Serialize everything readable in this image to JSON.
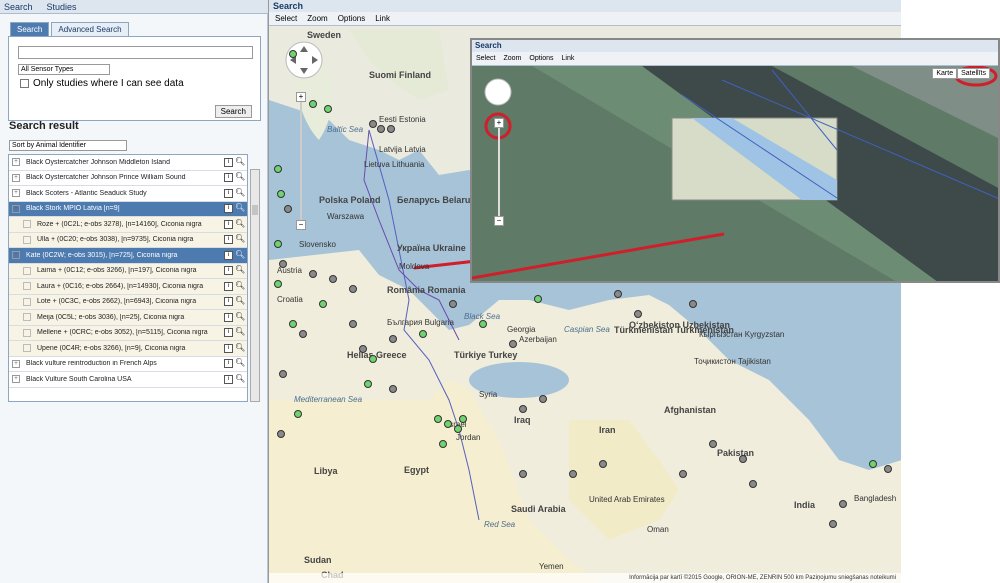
{
  "topbar": {
    "search": "Search",
    "studies": "Studies"
  },
  "tabs": [
    {
      "label": "Search"
    },
    {
      "label": "Advanced Search"
    }
  ],
  "search": {
    "value": "",
    "sensor_type": "All Sensor Types",
    "checkbox_label": "Only studies where I can see data",
    "button": "Search"
  },
  "result": {
    "title": "Search result",
    "sort": "Sort by Animal Identifier",
    "rows": [
      {
        "label": "Black Oystercatcher Johnson Middleton Island",
        "type": "study"
      },
      {
        "label": "Black Oystercatcher Johnson Prince William Sound",
        "type": "study"
      },
      {
        "label": "Black Scoters - Atlantic Seaduck Study",
        "type": "study"
      },
      {
        "label": "Black Stork MPIO Latvia [n=9]",
        "type": "selected"
      },
      {
        "label": "Roze + (0C2L; e-obs 3278), [n=14160], Ciconia nigra",
        "type": "child"
      },
      {
        "label": "Ulla + (0C20; e-obs 3038), [n=9735], Ciconia nigra",
        "type": "child"
      },
      {
        "label": "Kate (0C2W; e-obs 3015), [n=725], Ciconia nigra",
        "type": "selected"
      },
      {
        "label": "Laima + (0C12; e-obs 3266), [n=197], Ciconia nigra",
        "type": "child"
      },
      {
        "label": "Laura + (0C16; e-obs 2664), [n=14930], Ciconia nigra",
        "type": "child"
      },
      {
        "label": "Lote + (0C3C, e-obs 2662), [n=6943], Ciconia nigra",
        "type": "child"
      },
      {
        "label": "Meija (0C5L; e-obs 3036), [n=25], Ciconia nigra",
        "type": "child"
      },
      {
        "label": "Mellene + (0CRC; e-obs 3052), [n=5115], Ciconia nigra",
        "type": "child"
      },
      {
        "label": "Upene (0C4R; e-obs 3266), [n=9], Ciconia nigra",
        "type": "child"
      },
      {
        "label": "Black vulture reintroduction in French Alps",
        "type": "study"
      },
      {
        "label": "Black Vulture South Carolina USA",
        "type": "study"
      }
    ]
  },
  "map": {
    "title": "Search",
    "tools": [
      "Select",
      "Zoom",
      "Options",
      "Link"
    ],
    "labels": [
      {
        "t": "Sweden",
        "cls": "big"
      },
      {
        "t": "Suomi Finland",
        "cls": "big"
      },
      {
        "t": "Baltic Sea",
        "cls": "sea"
      },
      {
        "t": "Eesti Estonia",
        "cls": ""
      },
      {
        "t": "Latvija Latvia",
        "cls": ""
      },
      {
        "t": "Lietuva Lithuania",
        "cls": ""
      },
      {
        "t": "Polska Poland",
        "cls": "big"
      },
      {
        "t": "Warszawa",
        "cls": ""
      },
      {
        "t": "Беларусь Belarus",
        "cls": "big"
      },
      {
        "t": "Україна Ukraine",
        "cls": "big"
      },
      {
        "t": "Moldova",
        "cls": ""
      },
      {
        "t": "România Romania",
        "cls": "big"
      },
      {
        "t": "България Bulgaria",
        "cls": ""
      },
      {
        "t": "Black Sea",
        "cls": "sea"
      },
      {
        "t": "Hellas Greece",
        "cls": "big"
      },
      {
        "t": "Türkiye Turkey",
        "cls": "big"
      },
      {
        "t": "Georgia",
        "cls": ""
      },
      {
        "t": "Azerbaijan",
        "cls": ""
      },
      {
        "t": "Caspian Sea",
        "cls": "sea"
      },
      {
        "t": "Türkmenistan Turkmenistan",
        "cls": "big"
      },
      {
        "t": "Oʻzbekiston Uzbekistan",
        "cls": "big"
      },
      {
        "t": "Кыргызстан Kyrgyzstan",
        "cls": ""
      },
      {
        "t": "Тоҷикистон Tajikistan",
        "cls": ""
      },
      {
        "t": "Afghanistan",
        "cls": "big"
      },
      {
        "t": "Iran",
        "cls": "big"
      },
      {
        "t": "Iraq",
        "cls": "big"
      },
      {
        "t": "Syria",
        "cls": ""
      },
      {
        "t": "Mediterranean Sea",
        "cls": "sea"
      },
      {
        "t": "Libya",
        "cls": "big"
      },
      {
        "t": "Egypt",
        "cls": "big"
      },
      {
        "t": "Saudi Arabia",
        "cls": "big"
      },
      {
        "t": "Pakistan",
        "cls": "big"
      },
      {
        "t": "India",
        "cls": "big"
      },
      {
        "t": "Bangladesh",
        "cls": ""
      },
      {
        "t": "Oman",
        "cls": ""
      },
      {
        "t": "United Arab Emirates",
        "cls": ""
      },
      {
        "t": "Yemen",
        "cls": ""
      },
      {
        "t": "Sudan",
        "cls": "big"
      },
      {
        "t": "Chad",
        "cls": "big"
      },
      {
        "t": "Red Sea",
        "cls": "sea"
      },
      {
        "t": "Croatia",
        "cls": ""
      },
      {
        "t": "Austria",
        "cls": ""
      },
      {
        "t": "Slovensko",
        "cls": ""
      },
      {
        "t": "Jordan",
        "cls": ""
      },
      {
        "t": "Israel",
        "cls": ""
      }
    ],
    "footer": "Informācija par kartī ©2015 Google, ORION-ME, ZENRIN   500 km   Paziņojumu sniegšanas noteikumi"
  },
  "inset": {
    "title": "Search",
    "tools": [
      "Select",
      "Zoom",
      "Options",
      "Link"
    ],
    "map_types": [
      "Karte",
      "Satellīts"
    ]
  }
}
